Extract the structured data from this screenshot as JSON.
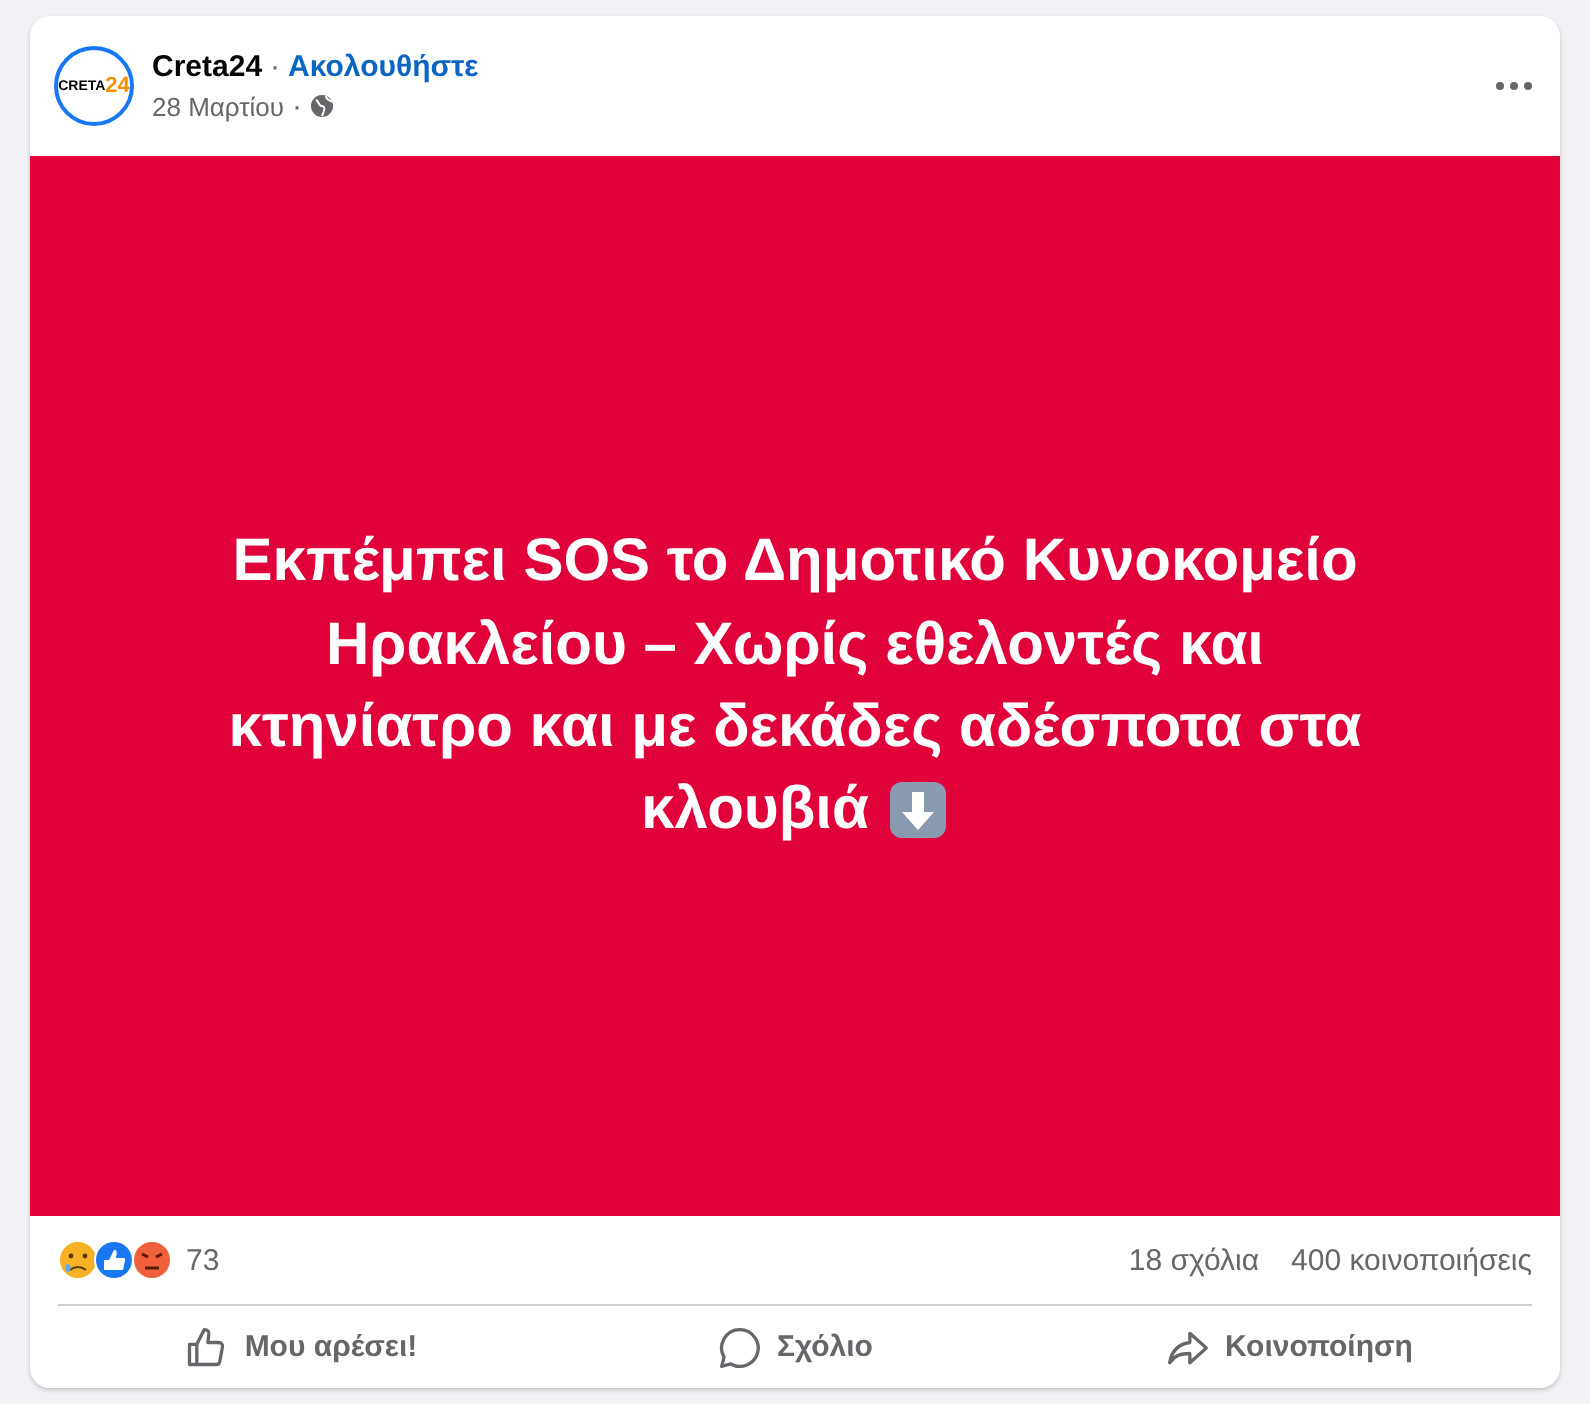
{
  "post": {
    "author": "Creta24",
    "follow_link": "Ακολουθήστε",
    "date": "28 Μαρτίου",
    "logo": {
      "word": "CRETA",
      "number": "24"
    },
    "separator": "·",
    "image_text_lines": [
      "Εκπέμπει SOS το Δημοτικό Κυνοκομείο",
      "Ηρακλείου – Χωρίς εθελοντές και",
      "κτηνίατρο και με δεκάδες αδέσποτα στα",
      "κλουβιά"
    ],
    "reactions_count": "73",
    "comments_count": "18 σχόλια",
    "shares_count": "400 κοινοποιήσεις",
    "actions": [
      {
        "kind": "like",
        "label": "Μου αρέσει!"
      },
      {
        "kind": "comment",
        "label": "Σχόλιο"
      },
      {
        "kind": "share",
        "label": "Κοινοποίηση"
      }
    ]
  }
}
